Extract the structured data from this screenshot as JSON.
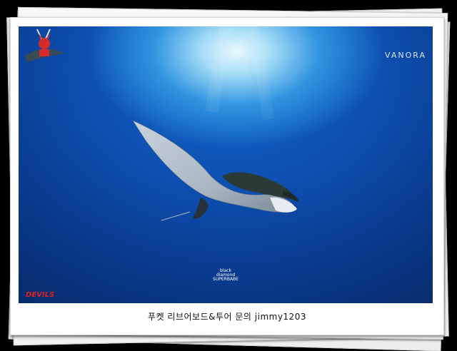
{
  "caption": "푸켓 리브어보드&투어 문의 jimmy1203",
  "brand": {
    "name": "VANORA"
  },
  "dive_logo": {
    "line1": "black",
    "line2": "diamond",
    "line3": "SUPERBABE"
  },
  "team_logo": {
    "label": "DEVILS"
  }
}
